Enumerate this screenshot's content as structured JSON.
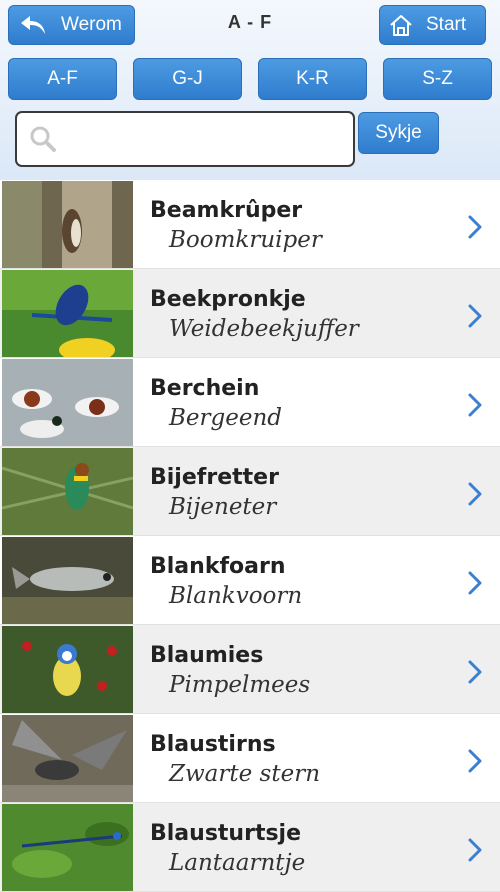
{
  "header": {
    "back_label": "Werom",
    "title": "A - F",
    "start_label": "Start"
  },
  "alphabet": [
    "A-F",
    "G-J",
    "K-R",
    "S-Z"
  ],
  "search": {
    "value": "",
    "placeholder": "",
    "button_label": "Sykje"
  },
  "birds": [
    {
      "name": "Beamkrûper",
      "latin": "Boomkruiper"
    },
    {
      "name": "Beekpronkje",
      "latin": "Weidebeekjuffer"
    },
    {
      "name": "Berchein",
      "latin": "Bergeend"
    },
    {
      "name": "Bijefretter",
      "latin": "Bijeneter"
    },
    {
      "name": "Blankfoarn",
      "latin": "Blankvoorn"
    },
    {
      "name": "Blaumies",
      "latin": "Pimpelmees"
    },
    {
      "name": "Blaustirns",
      "latin": "Zwarte stern"
    },
    {
      "name": "Blausturtsje",
      "latin": "Lantaarntje"
    }
  ],
  "colors": {
    "accent": "#3a86d6",
    "chevron": "#3a7fd0"
  }
}
